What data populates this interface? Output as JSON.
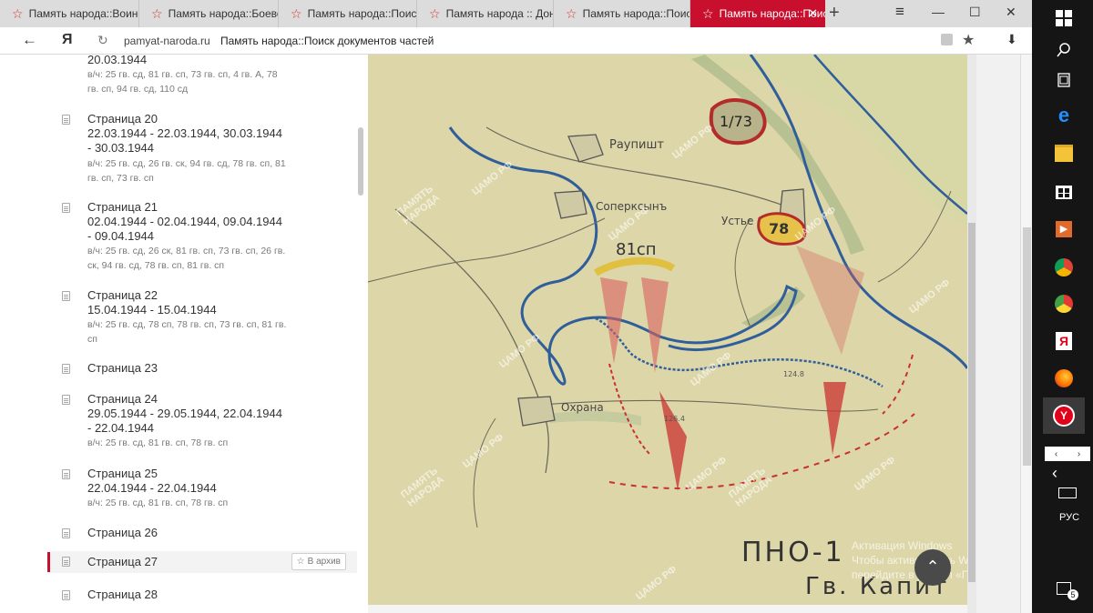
{
  "browser": {
    "tabs": [
      {
        "label": "Память народа::Воинск"
      },
      {
        "label": "Память народа::Боевое"
      },
      {
        "label": "Память народа::Поиск"
      },
      {
        "label": "Память народа :: Доне"
      },
      {
        "label": "Память народа::Поиск"
      },
      {
        "label": "Память народа::Поис",
        "active": true
      }
    ],
    "new_tab": "+",
    "window_controls": {
      "minimize": "—",
      "maximize": "☐",
      "close": "✕"
    },
    "menu_icon": "≡"
  },
  "addressbar": {
    "back": "←",
    "logo": "Я",
    "reload": "↻",
    "domain": "pamyat-naroda.ru",
    "page_title": "Память народа::Поиск документов частей",
    "download": "⬇"
  },
  "pages": [
    {
      "title": "",
      "dates": "20.03.1944",
      "units": "в/ч: 25 гв. сд, 81 гв. сп, 73 гв. сп, 4 гв. А, 78 гв. сп, 94 гв. сд, 110 сд"
    },
    {
      "title": "Страница 20",
      "dates": "22.03.1944 - 22.03.1944, 30.03.1944 - 30.03.1944",
      "units": "в/ч: 25 гв. сд, 26 гв. ск, 94 гв. сд, 78 гв. сп, 81 гв. сп, 73 гв. сп"
    },
    {
      "title": "Страница 21",
      "dates": "02.04.1944 - 02.04.1944, 09.04.1944 - 09.04.1944",
      "units": "в/ч: 25 гв. сд, 26 ск, 81 гв. сп, 73 гв. сп, 26 гв. ск, 94 гв. сд, 78 гв. сп, 81 гв. сп"
    },
    {
      "title": "Страница 22",
      "dates": "15.04.1944 - 15.04.1944",
      "units": "в/ч: 25 гв. сд, 78 сп, 78 гв. сп, 73 гв. сп, 81 гв. сп"
    },
    {
      "title": "Страница 23",
      "dates": "",
      "units": ""
    },
    {
      "title": "Страница 24",
      "dates": "29.05.1944 - 29.05.1944, 22.04.1944 - 22.04.1944",
      "units": "в/ч: 25 гв. сд, 81 гв. сп, 78 гв. сп"
    },
    {
      "title": "Страница 25",
      "dates": "22.04.1944 - 22.04.1944",
      "units": "в/ч: 25 гв. сд, 81 гв. сп, 78 гв. сп"
    },
    {
      "title": "Страница 26",
      "dates": "",
      "units": ""
    },
    {
      "title": "Страница 27",
      "dates": "",
      "units": "",
      "selected": true
    },
    {
      "title": "Страница 28",
      "dates": "",
      "units": ""
    }
  ],
  "archive_button": "В архив",
  "map": {
    "labels": {
      "raupisht": "Раупишт",
      "soperksyn": "Соперксынъ",
      "ustye": "Устье",
      "okhrana": "Охрана",
      "unit_81": "81сп",
      "unit_78": "78",
      "unit_73": "1/73",
      "height_1": "124.8",
      "height_2": "126.4",
      "doc_code_1": "ПНО-1",
      "doc_code_2": "Гв. Капит"
    },
    "watermark": "ЦАМО РФ",
    "watermark2": "ПАМЯТЬ НАРОДА",
    "activation_text": "Активация Windows\nЧтобы активировать Windows, перейдите в раздел «Параметры»."
  },
  "taskbar": {
    "language": "РУС",
    "notifications_count": "5"
  }
}
